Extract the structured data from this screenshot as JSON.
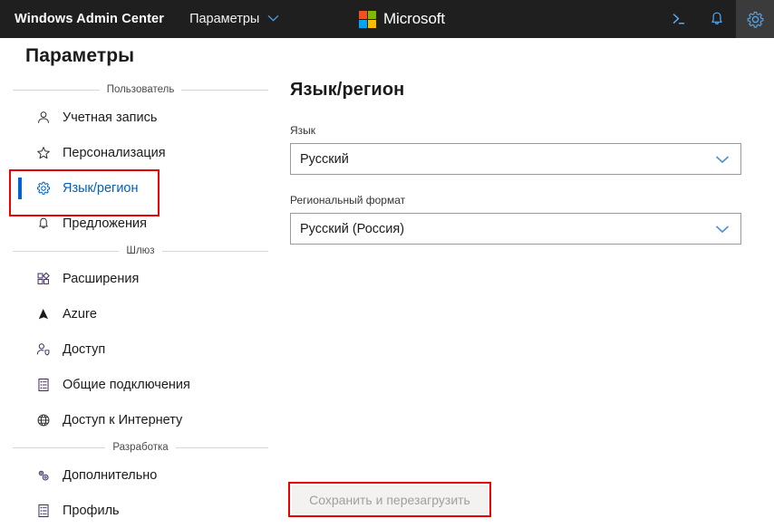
{
  "topbar": {
    "brand": "Windows Admin Center",
    "nav_dropdown_label": "Параметры",
    "chevron_icon": "chevron-down-icon",
    "microsoft_wordmark": "Microsoft",
    "actions": [
      {
        "name": "powershell-icon",
        "tooltip": "PowerShell",
        "active": false
      },
      {
        "name": "bell-icon",
        "tooltip": "Уведомления",
        "active": false
      },
      {
        "name": "gear-icon",
        "tooltip": "Параметры",
        "active": true
      }
    ],
    "background": "#1f1f1f",
    "accent": "#3b9bf0"
  },
  "page": {
    "title": "Параметры"
  },
  "sidebar": {
    "sections": [
      {
        "label": "Пользователь",
        "items": [
          {
            "label": "Учетная запись",
            "icon": "person-icon",
            "selected": false
          },
          {
            "label": "Персонализация",
            "icon": "star-icon",
            "selected": false
          },
          {
            "label": "Язык/регион",
            "icon": "gear-icon",
            "selected": true
          },
          {
            "label": "Предложения",
            "icon": "bell-icon",
            "selected": false
          }
        ]
      },
      {
        "label": "Шлюз",
        "items": [
          {
            "label": "Расширения",
            "icon": "extensions-grid-icon",
            "selected": false
          },
          {
            "label": "Azure",
            "icon": "azure-triangle-icon",
            "selected": false
          },
          {
            "label": "Доступ",
            "icon": "person-shield-icon",
            "selected": false
          },
          {
            "label": "Общие подключения",
            "icon": "list-document-icon",
            "selected": false
          },
          {
            "label": "Доступ к Интернету",
            "icon": "globe-icon",
            "selected": false
          }
        ]
      },
      {
        "label": "Разработка",
        "items": [
          {
            "label": "Дополнительно",
            "icon": "two-gears-icon",
            "selected": false
          },
          {
            "label": "Профиль",
            "icon": "list-document-icon",
            "selected": false
          }
        ]
      }
    ],
    "selected_accent": "#0065d2"
  },
  "main": {
    "title": "Язык/регион",
    "fields": [
      {
        "label": "Язык",
        "value": "Русский",
        "chevron_icon": "chevron-down-icon"
      },
      {
        "label": "Региональный формат",
        "value": "Русский (Россия)",
        "chevron_icon": "chevron-down-icon"
      }
    ],
    "save_button": {
      "label": "Сохранить и перезагрузить",
      "disabled": true
    }
  },
  "annotations": {
    "color": "#ee0000",
    "boxes": [
      {
        "name": "language-region-nav-highlight"
      },
      {
        "name": "save-button-highlight"
      }
    ]
  }
}
